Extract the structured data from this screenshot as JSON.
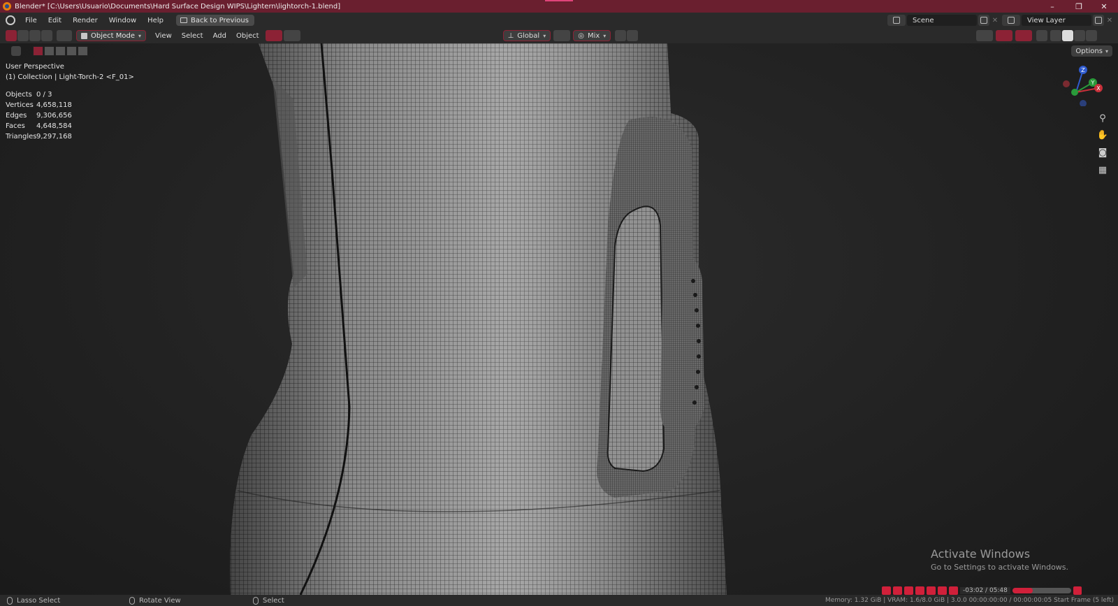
{
  "window": {
    "title": "Blender* [C:\\Users\\Usuario\\Documents\\Hard Surface Design WIPS\\Lightern\\lightorch-1.blend]",
    "controls": [
      "–",
      "❐",
      "✕"
    ]
  },
  "menubar": {
    "items": [
      "File",
      "Edit",
      "Render",
      "Window",
      "Help"
    ],
    "back_button": "Back to Previous",
    "scene": "Scene",
    "view_layer": "View Layer"
  },
  "header": {
    "mode": "Object Mode",
    "menus": [
      "View",
      "Select",
      "Add",
      "Object"
    ],
    "orientation": "Global",
    "snap": "Mix",
    "options": "Options"
  },
  "viewport": {
    "perspective": "User Perspective",
    "collection": "(1) Collection | Light-Torch-2 <F_01>",
    "stats": [
      {
        "label": "Objects",
        "value": "0 / 3"
      },
      {
        "label": "Vertices",
        "value": "4,658,118"
      },
      {
        "label": "Edges",
        "value": "9,306,656"
      },
      {
        "label": "Faces",
        "value": "4,648,584"
      },
      {
        "label": "Triangles",
        "value": "9,297,168"
      }
    ],
    "gizmo_axes": [
      "Z",
      "Y",
      "X"
    ]
  },
  "watermark": {
    "line1": "Activate Windows",
    "line2": "Go to Settings to activate Windows."
  },
  "statusbar": {
    "left": "Lasso Select",
    "middle": "Rotate View",
    "right": "Select",
    "info": "Memory: 1.32 GiB | VRAM: 1.6/8.0 GiB | 3.0.0   00:00:00:00 / 00:00:00:05   Start Frame (5 left)"
  },
  "timeline": {
    "time": "-03:02 / 05:48",
    "progress": 0.35
  },
  "colors": {
    "accent": "#8c2235",
    "title_bar": "#6a1f2f",
    "playback": "#d0203a"
  }
}
